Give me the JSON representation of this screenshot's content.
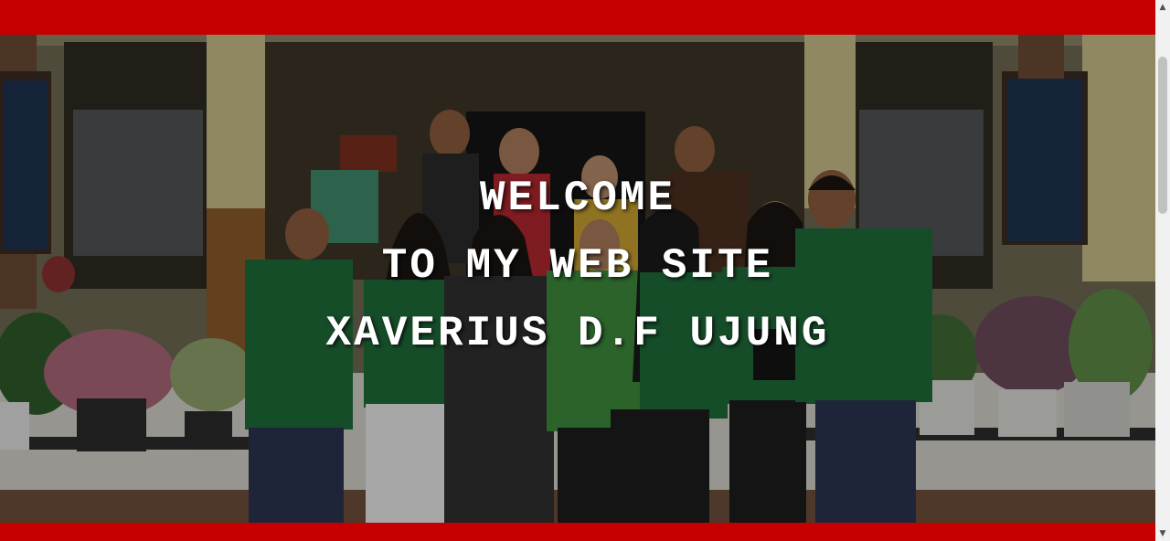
{
  "hero": {
    "line1": "WELCOME",
    "line2": "TO MY WEB SITE",
    "line3": "XAVERIUS D.F UJUNG",
    "photo_description_icon": "group-photo-icon"
  },
  "colors": {
    "accent": "#c60000",
    "text": "#ffffff",
    "jacket": "#1f6b3a"
  },
  "scrollbar": {
    "up_icon": "chevron-up-icon",
    "down_icon": "chevron-down-icon",
    "up_glyph": "▲",
    "down_glyph": "▼"
  }
}
